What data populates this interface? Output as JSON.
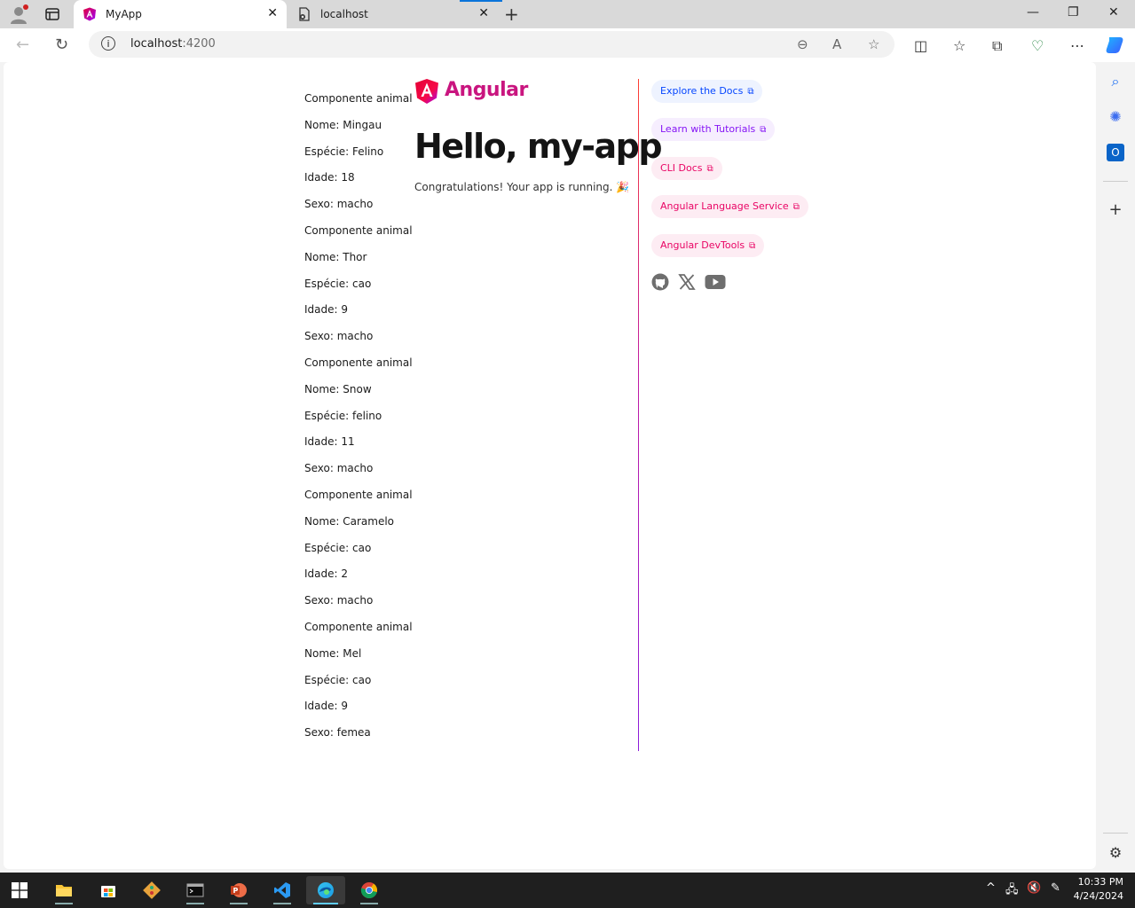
{
  "browser": {
    "tabs": [
      {
        "title": "MyApp",
        "active": true
      },
      {
        "title": "localhost",
        "active": false
      }
    ],
    "address": {
      "host": "localhost",
      "port": ":4200"
    }
  },
  "page": {
    "animals": [
      {
        "component": "Componente animal",
        "nome": "Nome: Mingau",
        "especie": "Espécie: Felino",
        "idade": "Idade: 18",
        "sexo": "Sexo: macho"
      },
      {
        "component": "Componente animal",
        "nome": "Nome: Thor",
        "especie": "Espécie: cao",
        "idade": "Idade: 9",
        "sexo": "Sexo: macho"
      },
      {
        "component": "Componente animal",
        "nome": "Nome: Snow",
        "especie": "Espécie: felino",
        "idade": "Idade: 11",
        "sexo": "Sexo: macho"
      },
      {
        "component": "Componente animal",
        "nome": "Nome: Caramelo",
        "especie": "Espécie: cao",
        "idade": "Idade: 2",
        "sexo": "Sexo: macho"
      },
      {
        "component": "Componente animal",
        "nome": "Nome: Mel",
        "especie": "Espécie: cao",
        "idade": "Idade: 9",
        "sexo": "Sexo: femea"
      }
    ],
    "logo_text": "Angular",
    "heading": "Hello, my-app",
    "subtitle": "Congratulations! Your app is running. 🎉",
    "links": [
      {
        "label": "Explore the Docs",
        "color": "#0546ff",
        "bg": "#eef3ff"
      },
      {
        "label": "Learn with Tutorials",
        "color": "#8514f5",
        "bg": "#f6eefe"
      },
      {
        "label": "CLI Docs",
        "color": "#e90464",
        "bg": "#fdecf3"
      },
      {
        "label": "Angular Language Service",
        "color": "#e90464",
        "bg": "#fdecf3"
      },
      {
        "label": "Angular DevTools",
        "color": "#e90464",
        "bg": "#fdecf3"
      }
    ],
    "socials": [
      "github-icon",
      "x-icon",
      "youtube-icon"
    ]
  },
  "taskbar": {
    "time": "10:33 PM",
    "date": "4/24/2024"
  }
}
